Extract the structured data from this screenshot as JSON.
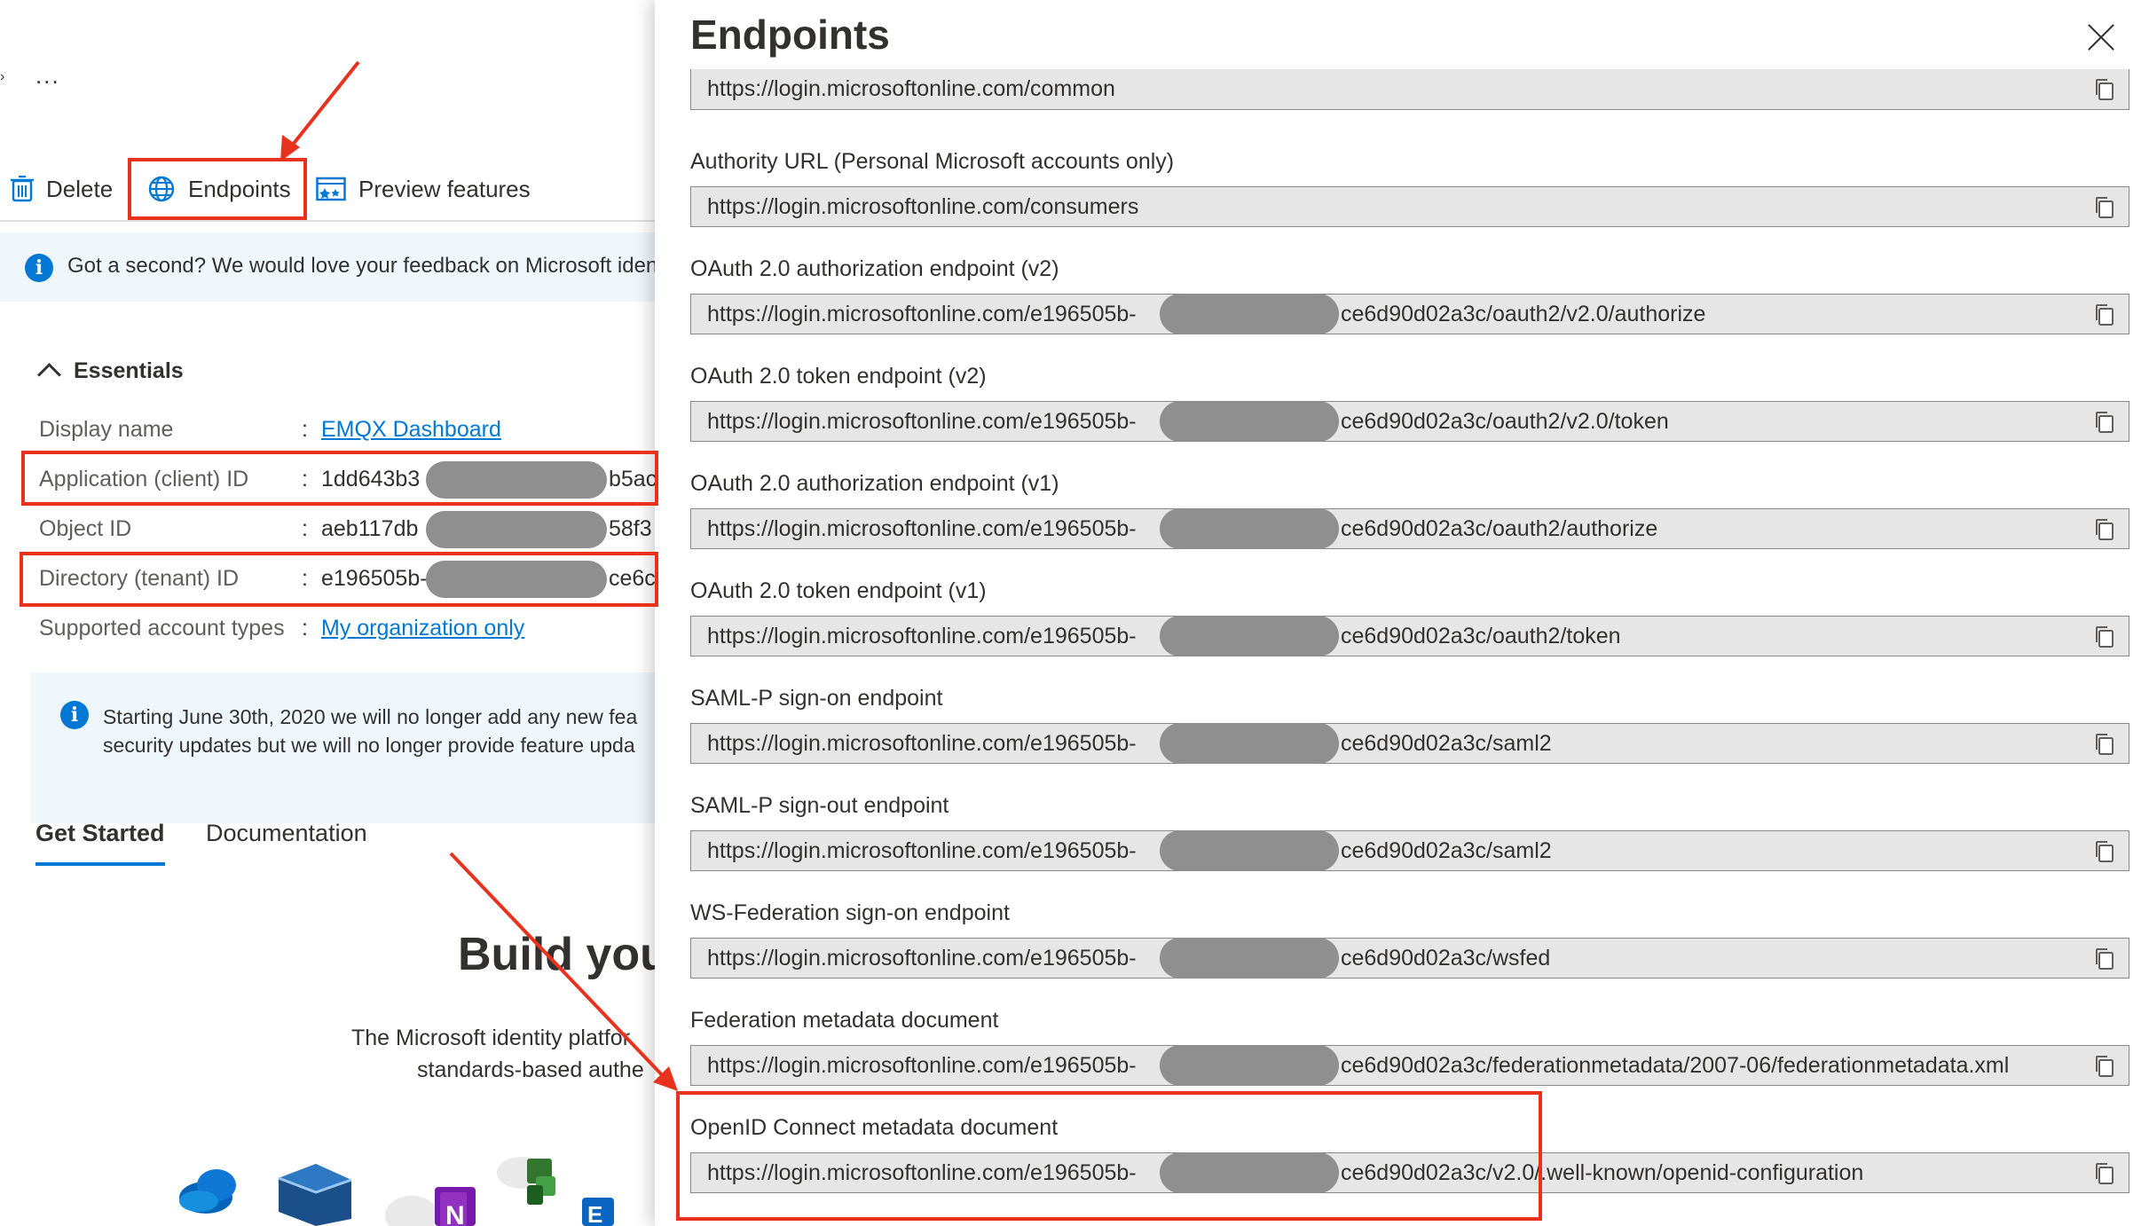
{
  "left": {
    "ellipsis": "...",
    "toolbar": {
      "delete_label": "Delete",
      "endpoints_label": "Endpoints",
      "preview_label": "Preview features"
    },
    "feedback": "Got a second? We would love your feedback on Microsoft iden",
    "essentials": {
      "title": "Essentials",
      "rows": [
        {
          "label": "Display name",
          "value": "EMQX Dashboard",
          "is_link": true
        },
        {
          "label": "Application (client) ID",
          "value": "1dd643b3",
          "tail": "b5ac"
        },
        {
          "label": "Object ID",
          "value": "aeb117db",
          "tail": "58f3"
        },
        {
          "label": "Directory (tenant) ID",
          "value": "e196505b-",
          "tail": "ce6c"
        },
        {
          "label": "Supported account types",
          "value": "My organization only",
          "is_link": true
        }
      ]
    },
    "notice": {
      "line1": "Starting June 30th, 2020 we will no longer add any new fea",
      "line2": "security updates but we will no longer provide feature upda"
    },
    "tabs": {
      "get_started": "Get Started",
      "documentation": "Documentation"
    },
    "build_heading": "Build you",
    "description": {
      "line1": "The Microsoft identity platfor",
      "line2": "standards-based authe"
    },
    "app_icons": [
      "onedrive-icon",
      "polyhedron-icon",
      "onenote-icon",
      "planner-icon",
      "exchange-icon"
    ]
  },
  "panel": {
    "title": "Endpoints",
    "endpoints": [
      {
        "label": "",
        "url_pre": "https://login.microsoftonline.com/common",
        "redacted": false
      },
      {
        "label": "Authority URL (Personal Microsoft accounts only)",
        "url_pre": "https://login.microsoftonline.com/consumers",
        "redacted": false
      },
      {
        "label": "OAuth 2.0 authorization endpoint (v2)",
        "url_pre": "https://login.microsoftonline.com/e196505b-",
        "url_post": "ce6d90d02a3c/oauth2/v2.0/authorize",
        "redacted": true
      },
      {
        "label": "OAuth 2.0 token endpoint (v2)",
        "url_pre": "https://login.microsoftonline.com/e196505b-",
        "url_post": "ce6d90d02a3c/oauth2/v2.0/token",
        "redacted": true
      },
      {
        "label": "OAuth 2.0 authorization endpoint (v1)",
        "url_pre": "https://login.microsoftonline.com/e196505b-",
        "url_post": "ce6d90d02a3c/oauth2/authorize",
        "redacted": true
      },
      {
        "label": "OAuth 2.0 token endpoint (v1)",
        "url_pre": "https://login.microsoftonline.com/e196505b-",
        "url_post": "ce6d90d02a3c/oauth2/token",
        "redacted": true
      },
      {
        "label": "SAML-P sign-on endpoint",
        "url_pre": "https://login.microsoftonline.com/e196505b-",
        "url_post": "ce6d90d02a3c/saml2",
        "redacted": true
      },
      {
        "label": "SAML-P sign-out endpoint",
        "url_pre": "https://login.microsoftonline.com/e196505b-",
        "url_post": "ce6d90d02a3c/saml2",
        "redacted": true
      },
      {
        "label": "WS-Federation sign-on endpoint",
        "url_pre": "https://login.microsoftonline.com/e196505b-",
        "url_post": "ce6d90d02a3c/wsfed",
        "redacted": true
      },
      {
        "label": "Federation metadata document",
        "url_pre": "https://login.microsoftonline.com/e196505b-",
        "url_post": "ce6d90d02a3c/federationmetadata/2007-06/federationmetadata.xml",
        "redacted": true
      },
      {
        "label": "OpenID Connect metadata document",
        "url_pre": "https://login.microsoftonline.com/e196505b-",
        "url_post": "ce6d90d02a3c/v2.0/.well-known/openid-configuration",
        "redacted": true
      }
    ]
  },
  "colors": {
    "accent": "#0078d4",
    "annotation_red": "#e8321e",
    "redaction": "#8f8f8f",
    "field_bg": "#e6e6e6",
    "info_bg": "#eff6fc"
  }
}
